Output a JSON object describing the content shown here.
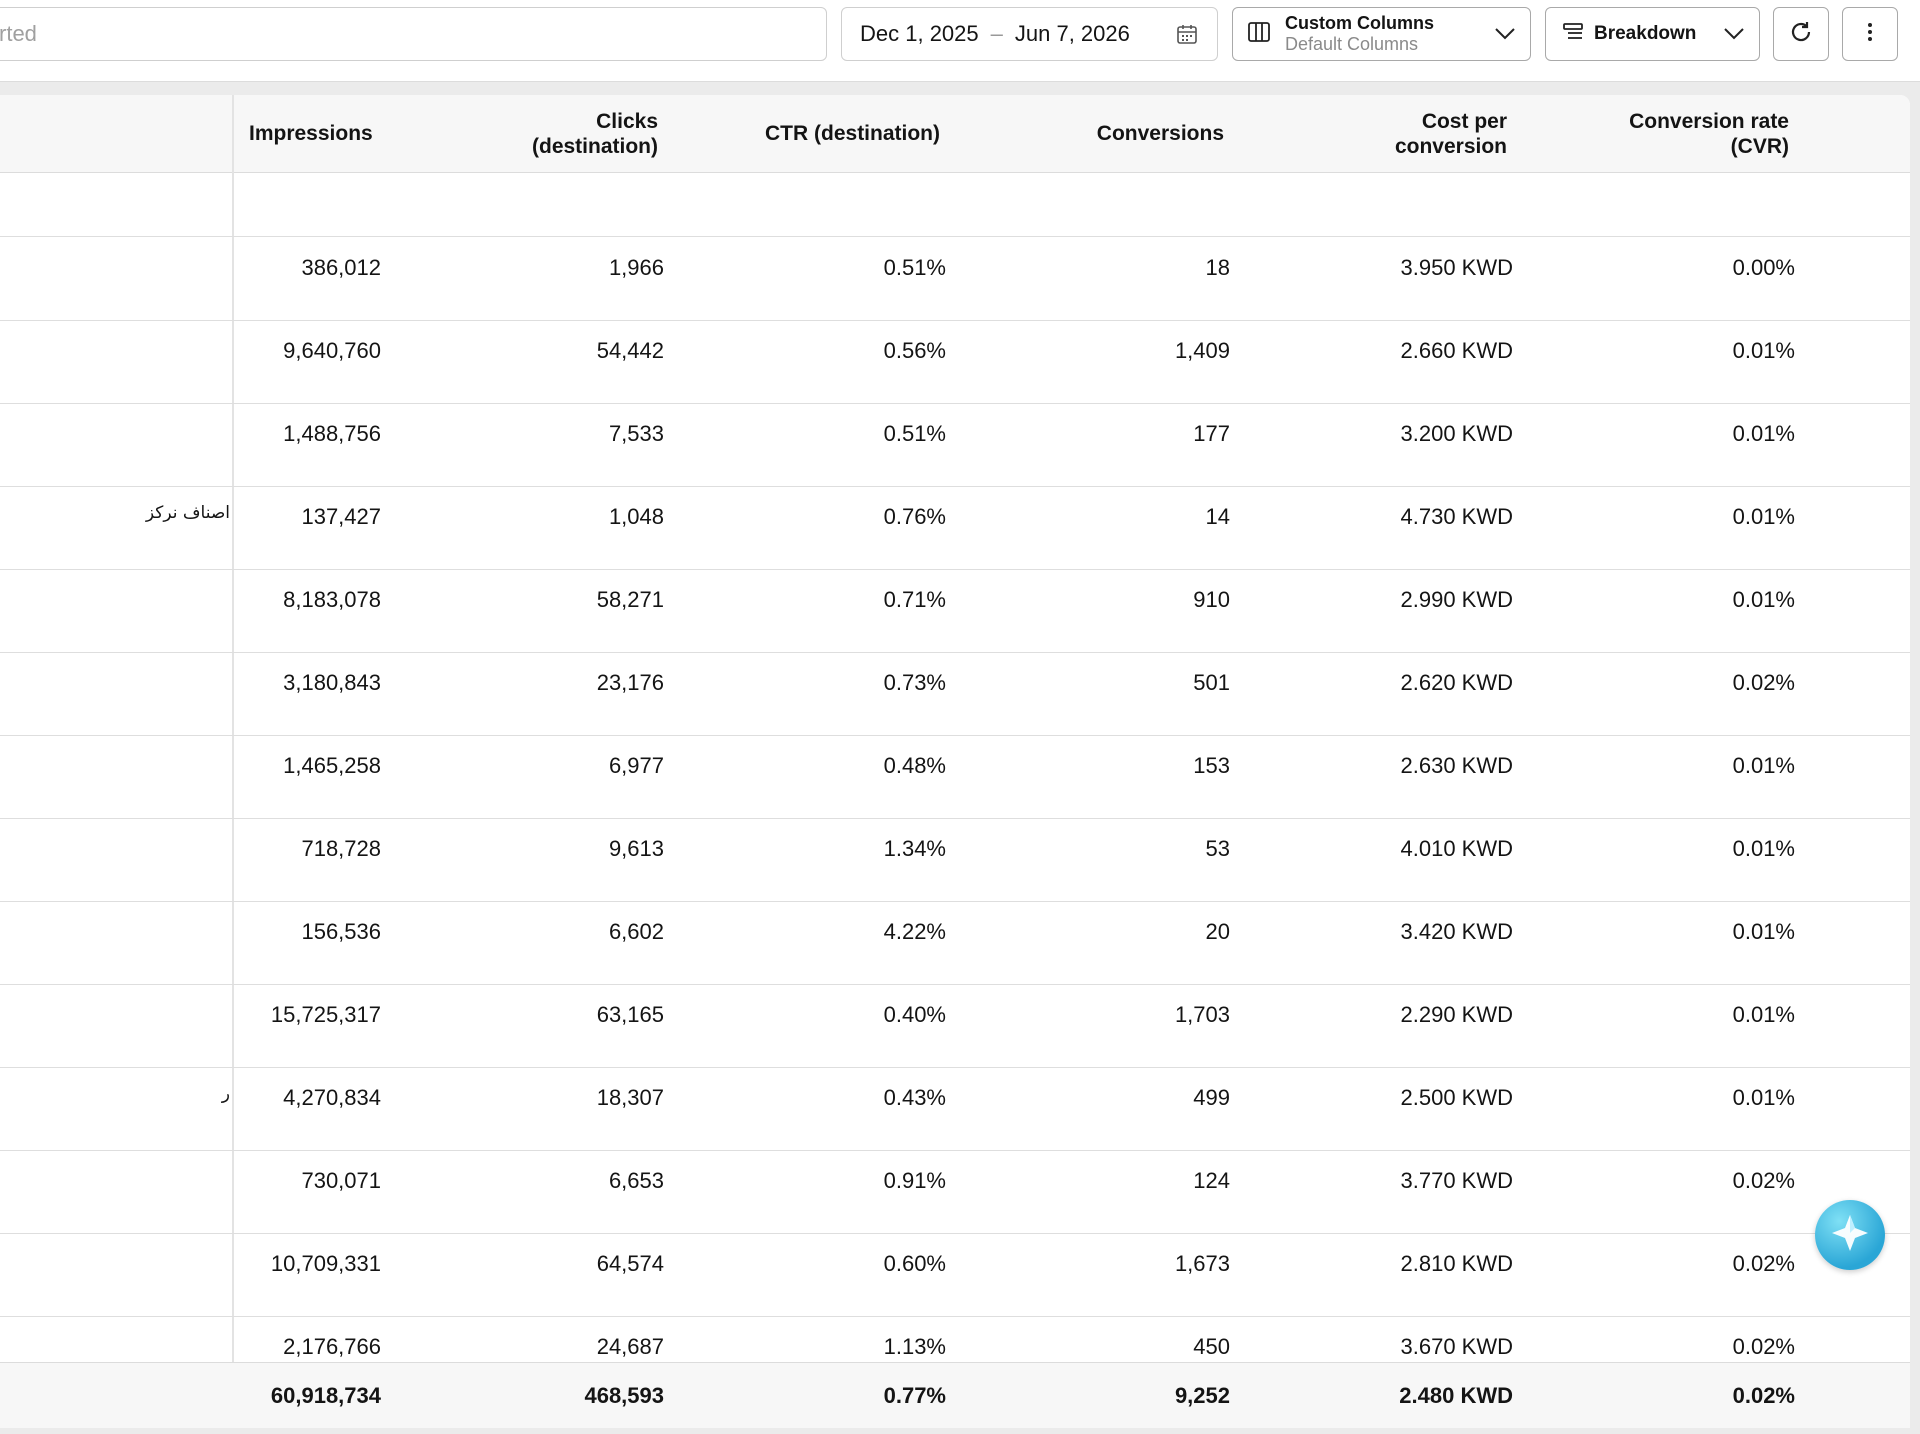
{
  "toolbar": {
    "search_placeholder": "rted",
    "date_start": "Dec 1, 2025",
    "date_separator": "–",
    "date_end": "Jun 7, 2026",
    "custom_columns_title": "Custom Columns",
    "custom_columns_sub": "Default Columns",
    "breakdown_label": "Breakdown"
  },
  "columns": [
    "Impressions",
    "Clicks\n(destination)",
    "CTR (destination)",
    "Conversions",
    "Cost per\nconversion",
    "Conversion rate\n(CVR)"
  ],
  "rows": [
    {
      "name": "",
      "impressions": "386,012",
      "clicks": "1,966",
      "ctr": "0.51%",
      "conversions": "18",
      "cpc": "3.950 KWD",
      "cvr": "0.00%"
    },
    {
      "name": "",
      "impressions": "9,640,760",
      "clicks": "54,442",
      "ctr": "0.56%",
      "conversions": "1,409",
      "cpc": "2.660 KWD",
      "cvr": "0.01%"
    },
    {
      "name": "",
      "impressions": "1,488,756",
      "clicks": "7,533",
      "ctr": "0.51%",
      "conversions": "177",
      "cpc": "3.200 KWD",
      "cvr": "0.01%"
    },
    {
      "name": "اصناف نركز",
      "impressions": "137,427",
      "clicks": "1,048",
      "ctr": "0.76%",
      "conversions": "14",
      "cpc": "4.730 KWD",
      "cvr": "0.01%"
    },
    {
      "name": "",
      "impressions": "8,183,078",
      "clicks": "58,271",
      "ctr": "0.71%",
      "conversions": "910",
      "cpc": "2.990 KWD",
      "cvr": "0.01%"
    },
    {
      "name": "",
      "impressions": "3,180,843",
      "clicks": "23,176",
      "ctr": "0.73%",
      "conversions": "501",
      "cpc": "2.620 KWD",
      "cvr": "0.02%"
    },
    {
      "name": "",
      "impressions": "1,465,258",
      "clicks": "6,977",
      "ctr": "0.48%",
      "conversions": "153",
      "cpc": "2.630 KWD",
      "cvr": "0.01%"
    },
    {
      "name": "",
      "impressions": "718,728",
      "clicks": "9,613",
      "ctr": "1.34%",
      "conversions": "53",
      "cpc": "4.010 KWD",
      "cvr": "0.01%"
    },
    {
      "name": "",
      "impressions": "156,536",
      "clicks": "6,602",
      "ctr": "4.22%",
      "conversions": "20",
      "cpc": "3.420 KWD",
      "cvr": "0.01%"
    },
    {
      "name": "",
      "impressions": "15,725,317",
      "clicks": "63,165",
      "ctr": "0.40%",
      "conversions": "1,703",
      "cpc": "2.290 KWD",
      "cvr": "0.01%"
    },
    {
      "name": "ر",
      "impressions": "4,270,834",
      "clicks": "18,307",
      "ctr": "0.43%",
      "conversions": "499",
      "cpc": "2.500 KWD",
      "cvr": "0.01%"
    },
    {
      "name": "",
      "impressions": "730,071",
      "clicks": "6,653",
      "ctr": "0.91%",
      "conversions": "124",
      "cpc": "3.770 KWD",
      "cvr": "0.02%"
    },
    {
      "name": "",
      "impressions": "10,709,331",
      "clicks": "64,574",
      "ctr": "0.60%",
      "conversions": "1,673",
      "cpc": "2.810 KWD",
      "cvr": "0.02%"
    },
    {
      "name": "",
      "impressions": "2,176,766",
      "clicks": "24,687",
      "ctr": "1.13%",
      "conversions": "450",
      "cpc": "3.670 KWD",
      "cvr": "0.02%"
    }
  ],
  "totals": {
    "impressions": "60,918,734",
    "clicks": "468,593",
    "ctr": "0.77%",
    "conversions": "9,252",
    "cpc": "2.480 KWD",
    "cvr": "0.02%"
  },
  "icons": {
    "calendar": "calendar-icon",
    "columns": "columns-icon",
    "breakdown": "breakdown-icon",
    "chevron": "chevron-down-icon",
    "refresh": "refresh-icon",
    "more": "more-vertical-icon",
    "assistant": "assistant-sparkle-icon"
  },
  "colors": {
    "accent": "#2aa6d6",
    "header_bg": "#f7f7f7",
    "border": "#dcdcdc"
  }
}
